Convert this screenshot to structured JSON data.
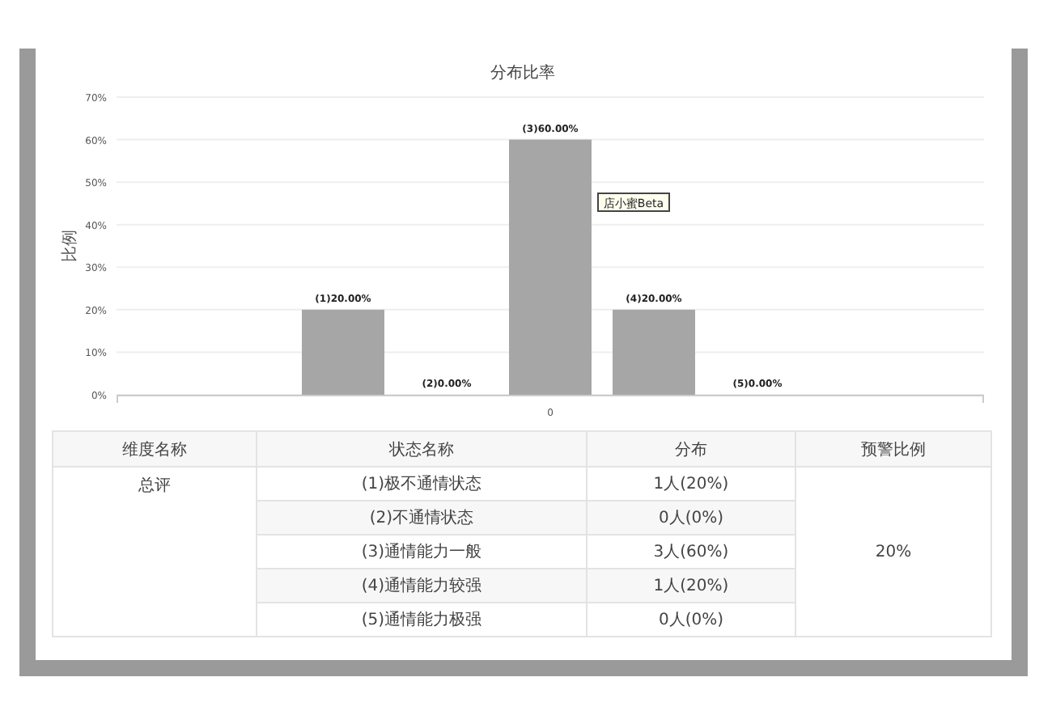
{
  "chart": {
    "chart_data": {
      "type": "bar",
      "title": "分布比率",
      "ylabel": "比例",
      "categories": [
        "0"
      ],
      "series": [
        {
          "color": "#a6a6a6",
          "values": [
            20
          ]
        },
        {
          "color": "#a6a6a6",
          "values": [
            0
          ]
        },
        {
          "color": "#a6a6a6",
          "values": [
            60
          ]
        },
        {
          "color": "#a6a6a6",
          "values": [
            20
          ]
        },
        {
          "color": "#a6a6a6",
          "values": [
            0
          ]
        }
      ],
      "ylim": [
        0,
        70
      ],
      "yticks": [
        {
          "value": 0,
          "label": "0%"
        },
        {
          "value": 10,
          "label": "10%"
        },
        {
          "value": 20,
          "label": "20%"
        },
        {
          "value": 30,
          "label": "30%"
        },
        {
          "value": 40,
          "label": "40%"
        },
        {
          "value": 50,
          "label": "50%"
        },
        {
          "value": 60,
          "label": "60%"
        },
        {
          "value": 70,
          "label": "70%"
        }
      ],
      "value_labels": [
        "(1)20.00%",
        "(2)0.00%",
        "(3)60.00%",
        "(4)20.00%",
        "(5)0.00%"
      ],
      "grid": true
    },
    "tooltip": "店小蜜Beta"
  },
  "table": {
    "columns": [
      "维度名称",
      "状态名称",
      "分布",
      "预警比例"
    ],
    "dimension": "总评",
    "warning_ratio": "20%",
    "rows": [
      {
        "state": "(1)极不通情状态",
        "distribution": "1人(20%)"
      },
      {
        "state": "(2)不通情状态",
        "distribution": "0人(0%)"
      },
      {
        "state": "(3)通情能力一般",
        "distribution": "3人(60%)"
      },
      {
        "state": "(4)通情能力较强",
        "distribution": "1人(20%)"
      },
      {
        "state": "(5)通情能力极强",
        "distribution": "0人(0%)"
      }
    ]
  }
}
